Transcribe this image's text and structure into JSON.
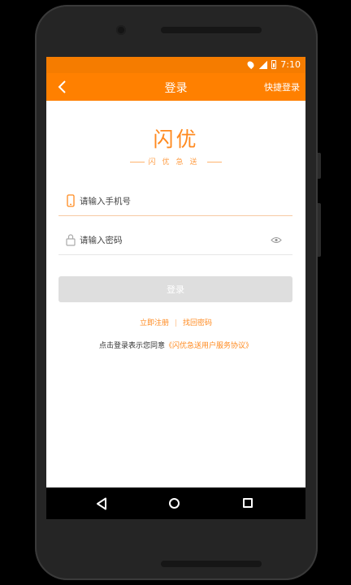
{
  "status_bar": {
    "time": "7:10",
    "icons": [
      "location-icon",
      "signal-icon",
      "battery-icon"
    ]
  },
  "nav": {
    "back_icon": "chevron-left-icon",
    "title": "登录",
    "quick_login": "快捷登录"
  },
  "brand": {
    "logo_text": "闪优",
    "slogan": "闪优急送"
  },
  "form": {
    "phone": {
      "placeholder": "请输入手机号",
      "value": "",
      "icon": "phone-icon"
    },
    "password": {
      "placeholder": "请输入密码",
      "value": "",
      "icon": "lock-icon",
      "toggle_icon": "eye-icon"
    },
    "login_button": "登录"
  },
  "links": {
    "register": "立即注册",
    "separator": "|",
    "forgot": "找回密码"
  },
  "agreement": {
    "prefix": "点击登录表示您同意",
    "link": "《闪优急送用户服务协议》"
  },
  "system_nav": [
    "back-icon",
    "home-icon",
    "recents-icon"
  ],
  "colors": {
    "primary": "#ff8000",
    "status_bar": "#f57c00",
    "accent_text": "#ff8a1f",
    "button_disabled": "#dedede"
  }
}
